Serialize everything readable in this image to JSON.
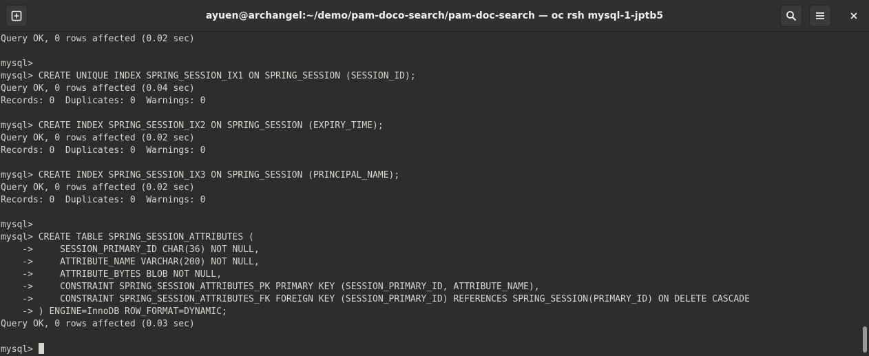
{
  "window": {
    "title": "ayuen@archangel:~/demo/pam-doco-search/pam-doc-search — oc rsh mysql-1-jptb5"
  },
  "toolbar": {
    "new_tab_icon": "new-tab-icon",
    "search_icon": "search-icon",
    "menu_icon": "hamburger-menu-icon",
    "close_icon": "close-icon"
  },
  "colors": {
    "background": "#2d2d2d",
    "titlebar": "#303030",
    "foreground": "#d3d7cf"
  },
  "terminal": {
    "lines": [
      "Query OK, 0 rows affected (0.02 sec)",
      "",
      "mysql>",
      "mysql> CREATE UNIQUE INDEX SPRING_SESSION_IX1 ON SPRING_SESSION (SESSION_ID);",
      "Query OK, 0 rows affected (0.04 sec)",
      "Records: 0  Duplicates: 0  Warnings: 0",
      "",
      "mysql> CREATE INDEX SPRING_SESSION_IX2 ON SPRING_SESSION (EXPIRY_TIME);",
      "Query OK, 0 rows affected (0.02 sec)",
      "Records: 0  Duplicates: 0  Warnings: 0",
      "",
      "mysql> CREATE INDEX SPRING_SESSION_IX3 ON SPRING_SESSION (PRINCIPAL_NAME);",
      "Query OK, 0 rows affected (0.02 sec)",
      "Records: 0  Duplicates: 0  Warnings: 0",
      "",
      "mysql>",
      "mysql> CREATE TABLE SPRING_SESSION_ATTRIBUTES (",
      "    ->     SESSION_PRIMARY_ID CHAR(36) NOT NULL,",
      "    ->     ATTRIBUTE_NAME VARCHAR(200) NOT NULL,",
      "    ->     ATTRIBUTE_BYTES BLOB NOT NULL,",
      "    ->     CONSTRAINT SPRING_SESSION_ATTRIBUTES_PK PRIMARY KEY (SESSION_PRIMARY_ID, ATTRIBUTE_NAME),",
      "    ->     CONSTRAINT SPRING_SESSION_ATTRIBUTES_FK FOREIGN KEY (SESSION_PRIMARY_ID) REFERENCES SPRING_SESSION(PRIMARY_ID) ON DELETE CASCADE",
      "    -> ) ENGINE=InnoDB ROW_FORMAT=DYNAMIC;",
      "Query OK, 0 rows affected (0.03 sec)",
      ""
    ],
    "prompt": "mysql> "
  }
}
